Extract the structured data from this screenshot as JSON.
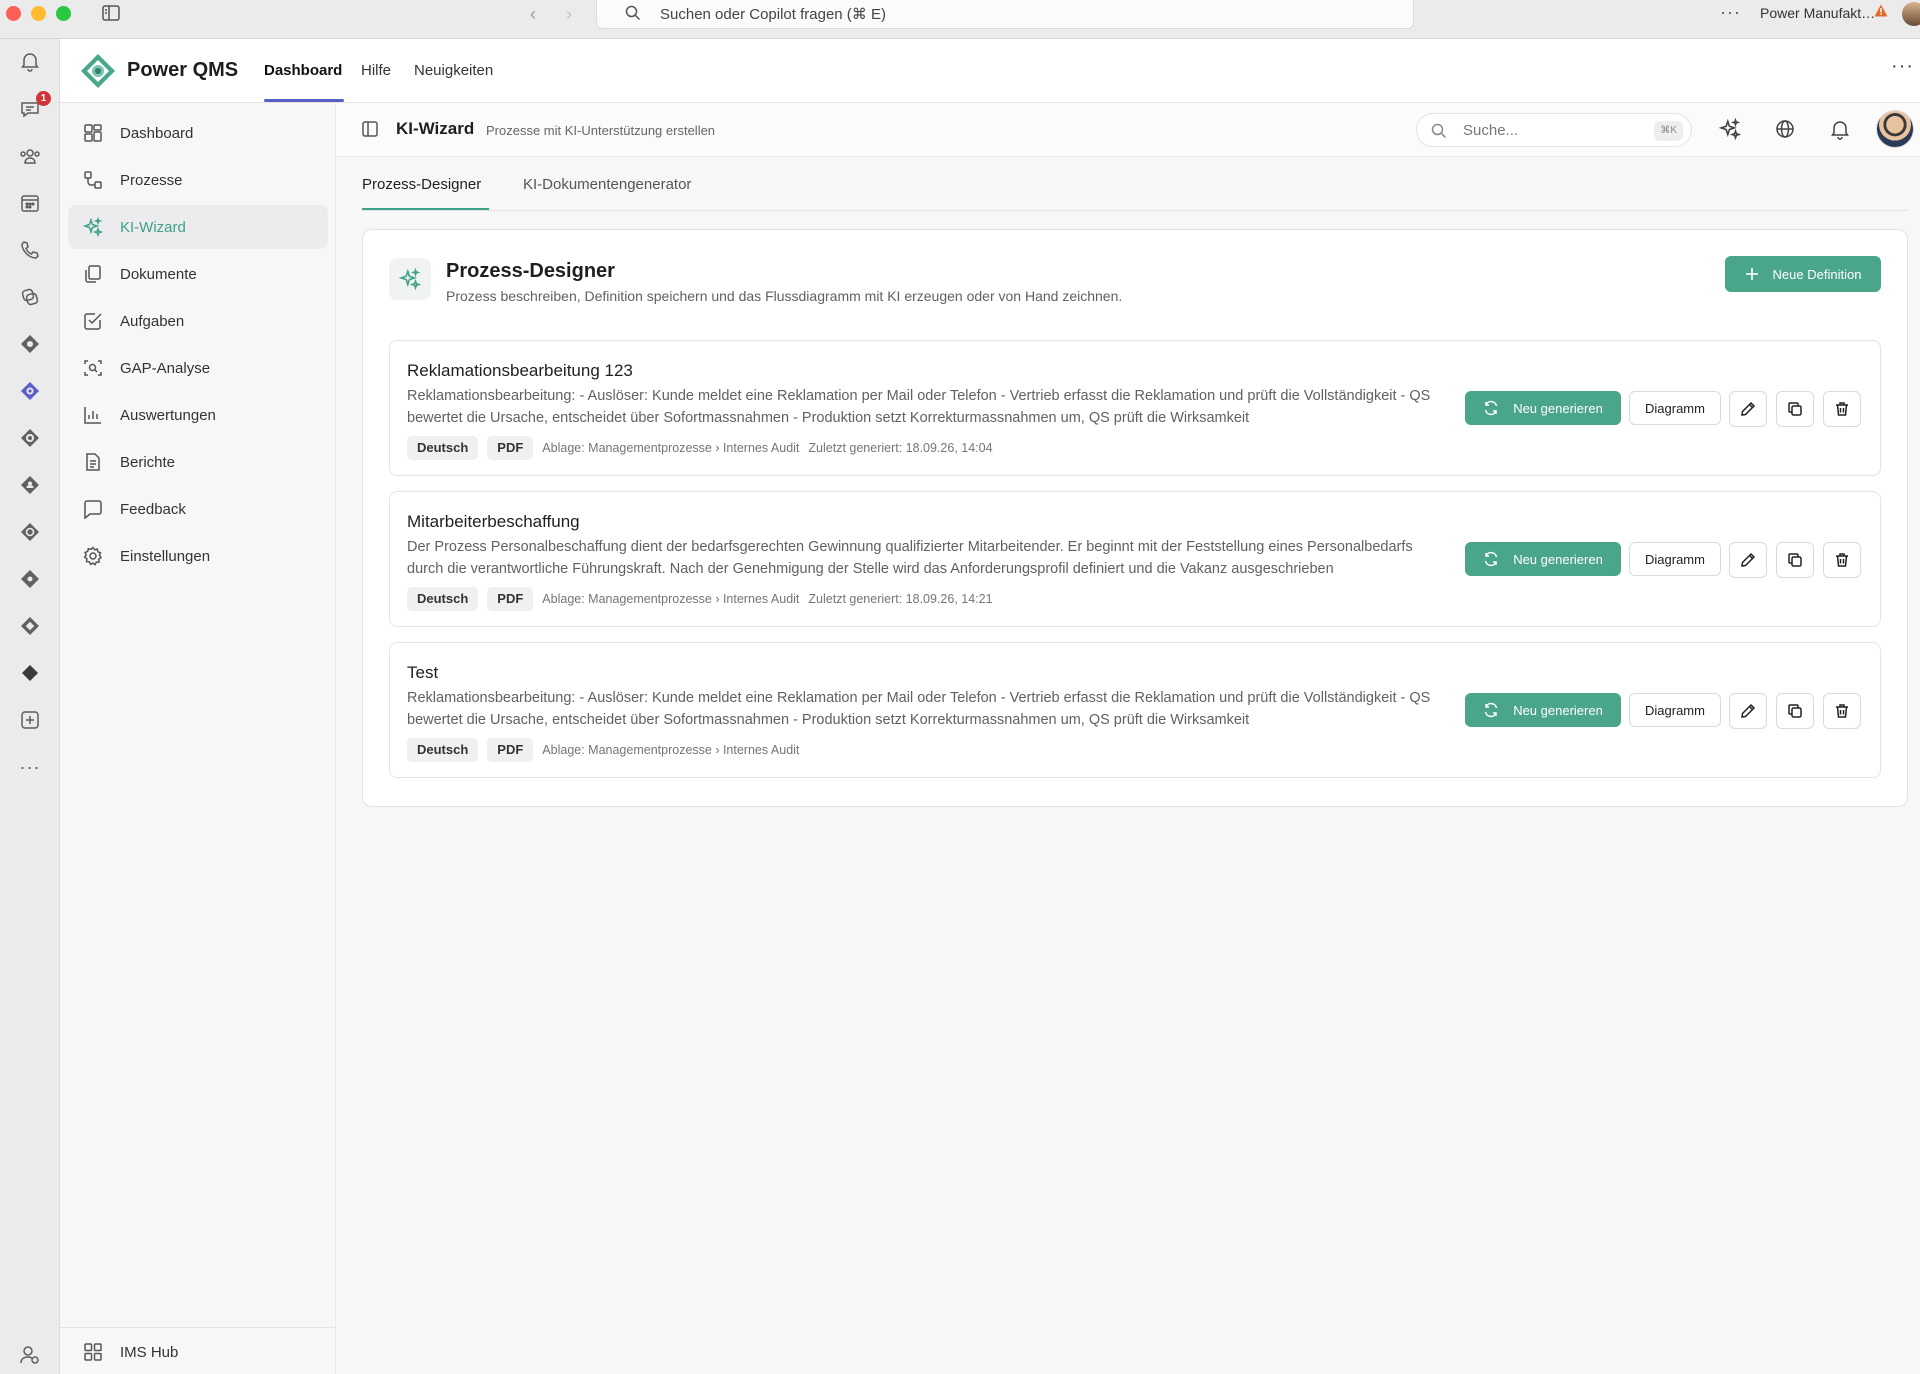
{
  "titlebar": {
    "search_text": "Suchen oder Copilot fragen (⌘ E)",
    "tenant": "Power Manufakt…",
    "more": "···"
  },
  "rail": {
    "badge_count": "1",
    "more": "···"
  },
  "app": {
    "name": "Power QMS",
    "nav_tabs": [
      "Dashboard",
      "Hilfe",
      "Neuigkeiten"
    ],
    "more": "···"
  },
  "sidebar": {
    "items": [
      {
        "label": "Dashboard",
        "icon": "dashboard-icon"
      },
      {
        "label": "Prozesse",
        "icon": "flow-icon"
      },
      {
        "label": "KI-Wizard",
        "icon": "sparkle-icon"
      },
      {
        "label": "Dokumente",
        "icon": "documents-icon"
      },
      {
        "label": "Aufgaben",
        "icon": "task-icon"
      },
      {
        "label": "GAP-Analyse",
        "icon": "scan-icon"
      },
      {
        "label": "Auswertungen",
        "icon": "chart-icon"
      },
      {
        "label": "Berichte",
        "icon": "report-icon"
      },
      {
        "label": "Feedback",
        "icon": "feedback-icon"
      },
      {
        "label": "Einstellungen",
        "icon": "gear-icon"
      }
    ],
    "active_index": 2,
    "bottom_label": "IMS Hub"
  },
  "content_header": {
    "title": "KI-Wizard",
    "subtitle": "Prozesse mit KI-Unterstützung erstellen",
    "search_placeholder": "Suche...",
    "search_shortcut": "⌘K"
  },
  "tabs": [
    "Prozess-Designer",
    "KI-Dokumentengenerator"
  ],
  "designer": {
    "title": "Prozess-Designer",
    "description": "Prozess beschreiben, Definition speichern und das Flussdiagramm mit KI erzeugen oder von Hand zeichnen.",
    "new_button": "Neue Definition",
    "regen_label": "Neu generieren",
    "diagram_label": "Diagramm",
    "processes": [
      {
        "title": "Reklamationsbearbeitung 123",
        "description": "Reklamationsbearbeitung: - Auslöser: Kunde meldet eine Reklamation per Mail oder Telefon - Vertrieb erfasst die Reklamation und prüft die Vollständigkeit - QS bewertet die Ursache, entscheidet über Sofortmassnahmen - Produktion setzt Korrekturmassnahmen um, QS prüft die Wirksamkeit",
        "language": "Deutsch",
        "format": "PDF",
        "location": "Ablage: Managementprozesse › Internes Audit",
        "generated": "Zuletzt generiert: 18.09.26, 14:04"
      },
      {
        "title": "Mitarbeiterbeschaffung",
        "description": "Der Prozess Personalbeschaffung dient der bedarfsgerechten Gewinnung qualifizierter Mitarbeitender. Er beginnt mit der Feststellung eines Personalbedarfs durch die verantwortliche Führungskraft. Nach der Genehmigung der Stelle wird das Anforderungsprofil definiert und die Vakanz ausgeschrieben",
        "language": "Deutsch",
        "format": "PDF",
        "location": "Ablage: Managementprozesse › Internes Audit",
        "generated": "Zuletzt generiert: 18.09.26, 14:21"
      },
      {
        "title": "Test",
        "description": "Reklamationsbearbeitung: - Auslöser: Kunde meldet eine Reklamation per Mail oder Telefon - Vertrieb erfasst die Reklamation und prüft die Vollständigkeit - QS bewertet die Ursache, entscheidet über Sofortmassnahmen - Produktion setzt Korrekturmassnahmen um, QS prüft die Wirksamkeit",
        "language": "Deutsch",
        "format": "PDF",
        "location": "Ablage: Managementprozesse › Internes Audit",
        "generated": ""
      }
    ]
  },
  "colors": {
    "accent": "#4aa68b",
    "nav_indicator": "#5a5fc8",
    "badge": "#d13438"
  }
}
